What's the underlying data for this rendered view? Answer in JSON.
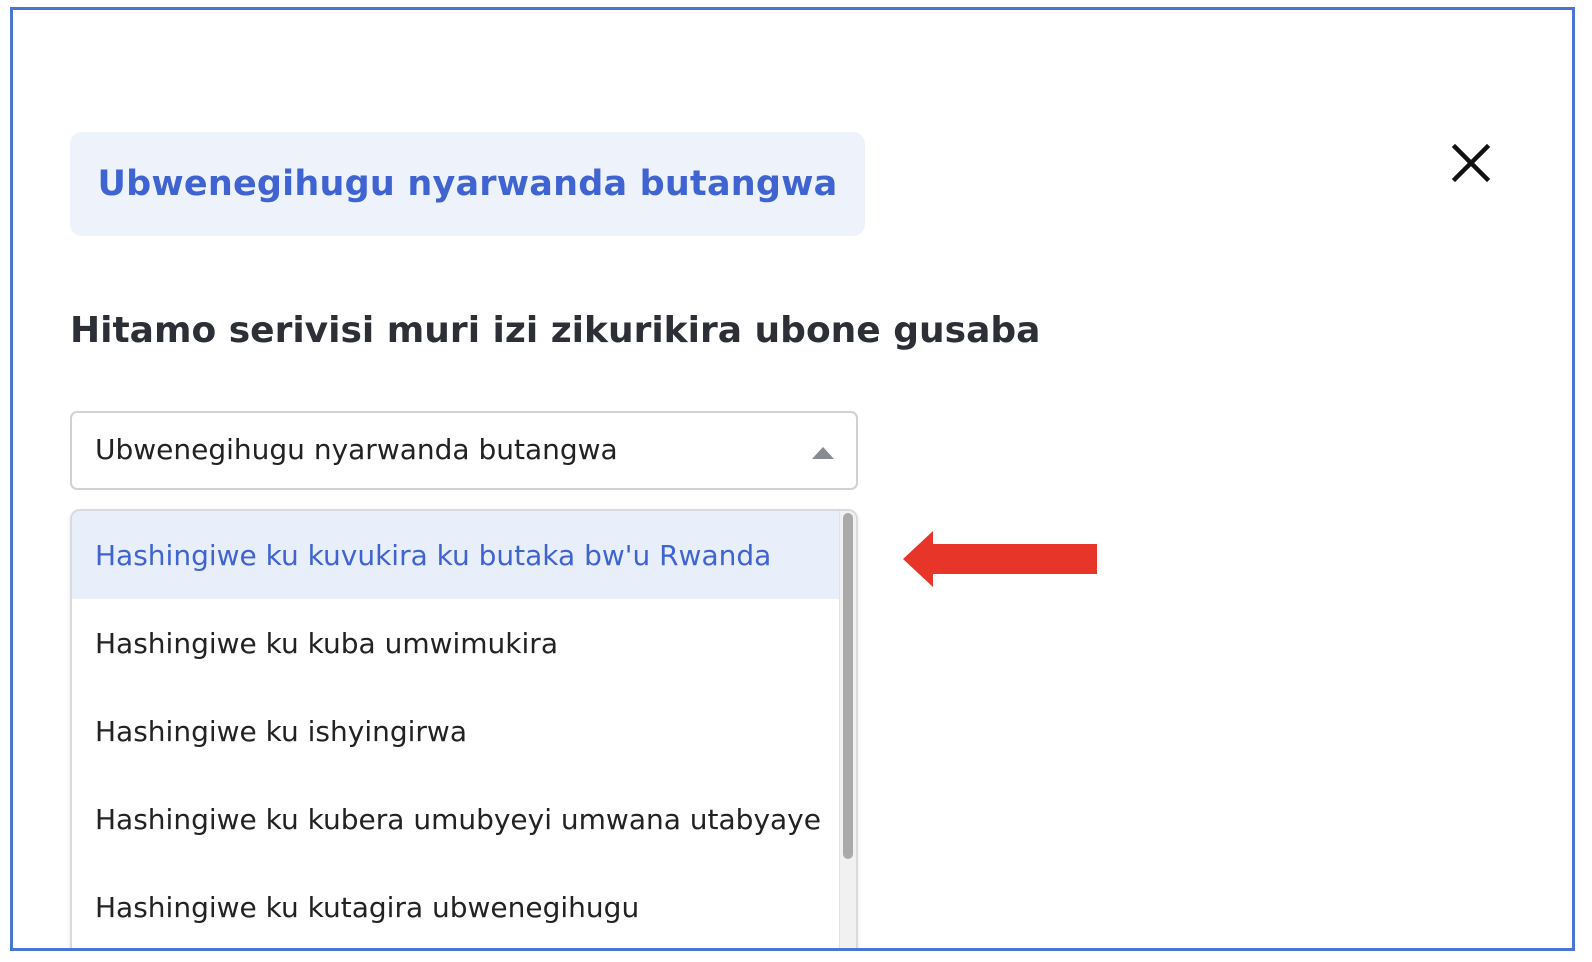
{
  "service_chip": {
    "label": "Ubwenegihugu nyarwanda butangwa"
  },
  "heading": "Hitamo serivisi muri izi zikurikira ubone gusaba",
  "select": {
    "value": "Ubwenegihugu nyarwanda butangwa",
    "icon": "caret-up-icon"
  },
  "dropdown": {
    "options": [
      {
        "label": "Hashingiwe ku kuvukira ku butaka bw'u Rwanda",
        "active": true
      },
      {
        "label": "Hashingiwe ku kuba umwimukira",
        "active": false
      },
      {
        "label": "Hashingiwe ku ishyingirwa",
        "active": false
      },
      {
        "label": "Hashingiwe ku kubera umubyeyi umwana utabyaye",
        "active": false
      },
      {
        "label": "Hashingiwe ku kutagira ubwenegihugu",
        "active": false
      }
    ]
  },
  "colors": {
    "frame_border": "#4a76d3",
    "accent_blue": "#3f63d1",
    "chip_bg": "#eef2fb",
    "active_option_bg": "#e8eefa",
    "annotation_arrow": "#e8352a"
  },
  "icons": {
    "close": "close-icon",
    "annotation": "red-arrow-icon"
  }
}
